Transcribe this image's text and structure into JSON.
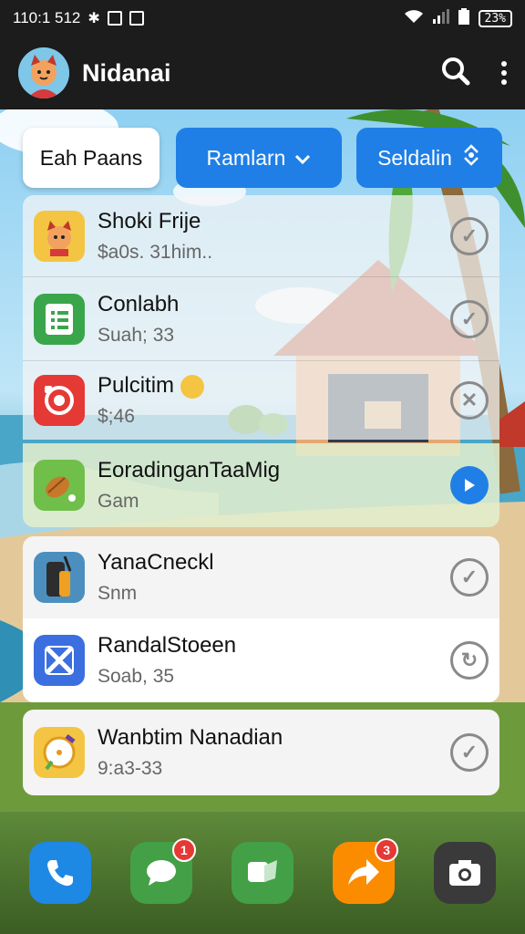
{
  "status_bar": {
    "time": "110:1 512",
    "battery": "23%"
  },
  "app_bar": {
    "title": "Nidanai"
  },
  "filters": {
    "chip1": "Eah Paans",
    "chip2": "Ramlarn",
    "chip3": "Seldalin"
  },
  "list": {
    "items": [
      {
        "title": "Shoki Frije",
        "sub": "$a0s. 31him..",
        "icon": "cat-app-icon",
        "action": "check-icon"
      },
      {
        "title": "Conlabh",
        "sub": "Suah; 33",
        "icon": "notes-app-icon",
        "action": "check-icon"
      },
      {
        "title": "Pulcitim",
        "sub": "$;46",
        "icon": "camera-app-icon",
        "action": "check-icon"
      },
      {
        "title": "EoradinganTaaMig",
        "sub": "Gam",
        "icon": "food-app-icon",
        "action": "play-icon"
      },
      {
        "title": "YanaCneckl",
        "sub": "Snm",
        "icon": "phone-tool-app-icon",
        "action": "check-icon"
      },
      {
        "title": "RandalStoeen",
        "sub": "Soab, 35",
        "icon": "x-app-icon",
        "action": "refresh-icon"
      },
      {
        "title": "Wanbtim Nanadian",
        "sub": "9:a3-33",
        "icon": "yellow-app-icon",
        "action": "check-icon"
      }
    ]
  },
  "dock": {
    "apps": [
      {
        "name": "phone-icon",
        "badge": ""
      },
      {
        "name": "messages-icon",
        "badge": "1"
      },
      {
        "name": "chat-icon",
        "badge": ""
      },
      {
        "name": "share-icon",
        "badge": "3"
      },
      {
        "name": "camera-icon",
        "badge": ""
      }
    ]
  },
  "colors": {
    "accent": "#1f7fe6",
    "badge": "#e53935"
  }
}
